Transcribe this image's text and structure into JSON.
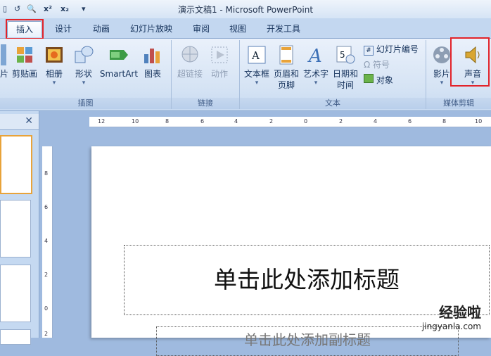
{
  "window": {
    "title": "演示文稿1 - Microsoft PowerPoint"
  },
  "qat": {
    "superscript": "x²",
    "subscript": "x₂"
  },
  "tabs": [
    "插入",
    "设计",
    "动画",
    "幻灯片放映",
    "审阅",
    "视图",
    "开发工具"
  ],
  "active_tab": "插入",
  "ribbon": {
    "groups": {
      "illustrations": "插图",
      "links": "链接",
      "text": "文本",
      "media": "媒体剪辑"
    },
    "buttons": {
      "picture_partial": "片",
      "clipart": "剪贴画",
      "album": "相册",
      "shapes": "形状",
      "smartart": "SmartArt",
      "chart": "图表",
      "hyperlink": "超链接",
      "action": "动作",
      "textbox": "文本框",
      "header_footer_1": "页眉和",
      "header_footer_2": "页脚",
      "wordart": "艺术字",
      "datetime_1": "日期和",
      "datetime_2": "时间",
      "slide_number": "幻灯片编号",
      "symbol": "符号",
      "object": "对象",
      "movie": "影片",
      "sound": "声音"
    }
  },
  "slide": {
    "title_placeholder": "单击此处添加标题",
    "subtitle_placeholder": "单击此处添加副标题"
  },
  "ruler": {
    "h_ticks": [
      "12",
      "10",
      "8",
      "6",
      "4",
      "2",
      "0",
      "2",
      "4",
      "6",
      "8",
      "10"
    ],
    "v_ticks": [
      "8",
      "6",
      "4",
      "2",
      "0",
      "2"
    ]
  },
  "watermark": {
    "brand": "经验啦",
    "url": "jingyanla.com"
  },
  "colors": {
    "highlight_red": "#e2232a",
    "ribbon_blue": "#d5e3f4"
  }
}
